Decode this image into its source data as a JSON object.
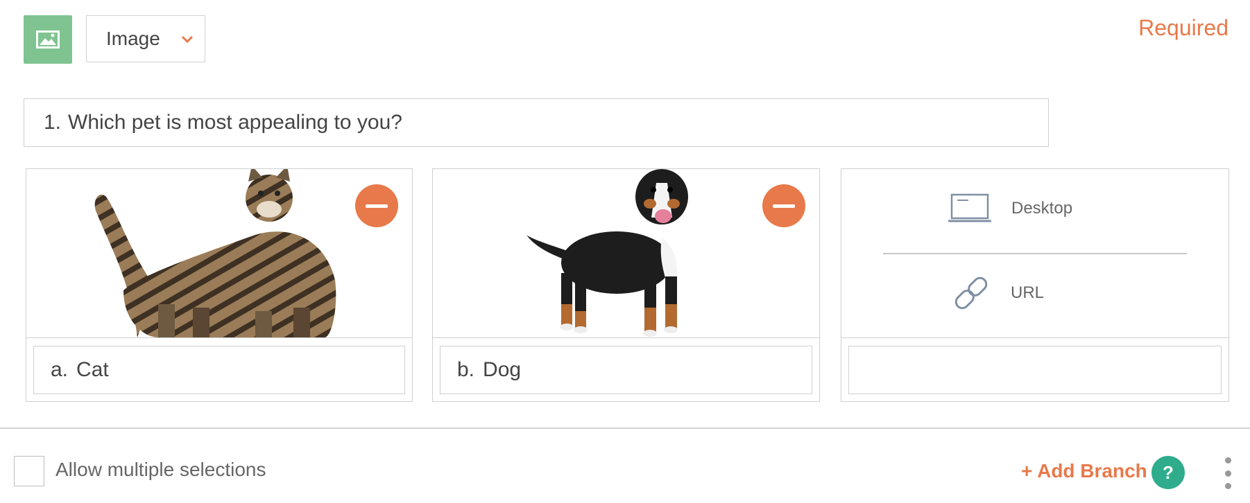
{
  "header": {
    "type_icon": "image-icon",
    "type_select": {
      "value": "Image",
      "chevron_icon": "chevron-down-icon"
    },
    "required_label": "Required",
    "accent_color": "#e8794a",
    "type_icon_bg": "#7fc490"
  },
  "question": {
    "number": "1.",
    "text": "Which pet is most appealing to you?"
  },
  "choices": [
    {
      "letter": "a.",
      "label": "Cat",
      "image": "tabby-cat-photo",
      "remove_icon": "minus-circle-icon"
    },
    {
      "letter": "b.",
      "label": "Dog",
      "image": "bernese-dog-photo",
      "remove_icon": "minus-circle-icon"
    },
    {
      "letter": "",
      "label": "",
      "upload_options": [
        {
          "label": "Desktop",
          "icon": "laptop-icon"
        },
        {
          "label": "URL",
          "icon": "link-icon"
        }
      ]
    }
  ],
  "footer": {
    "allow_multiple_label": "Allow multiple selections",
    "allow_multiple_checked": false,
    "add_branch_label": "+ Add Branch",
    "help_label": "?",
    "help_color": "#2eac8c",
    "more_icon": "kebab-menu-icon"
  }
}
